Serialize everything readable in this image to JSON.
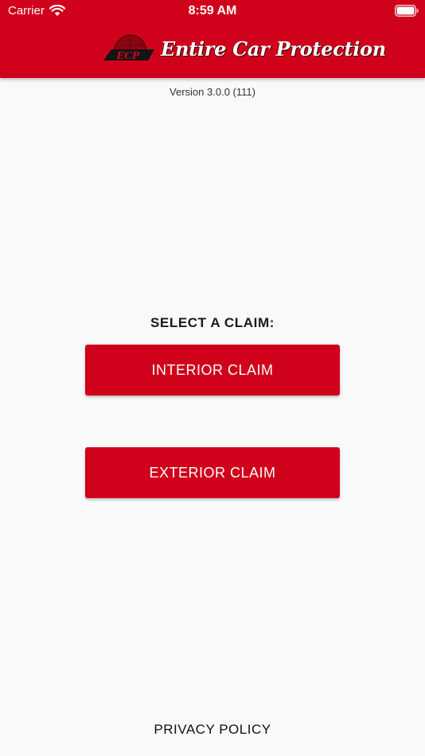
{
  "status_bar": {
    "carrier": "Carrier",
    "time": "8:59 AM",
    "icons": [
      "wifi-icon",
      "battery-icon"
    ]
  },
  "header": {
    "logo_text": "ECP",
    "brand_name": "Entire Car Protection",
    "background_color": "#d0021b"
  },
  "app": {
    "version": "Version 3.0.0 (111)"
  },
  "main": {
    "heading": "SELECT A CLAIM:",
    "buttons": [
      {
        "label": "INTERIOR CLAIM"
      },
      {
        "label": "EXTERIOR CLAIM"
      }
    ],
    "button_color": "#d0021b"
  },
  "footer": {
    "privacy_label": "PRIVACY POLICY"
  }
}
